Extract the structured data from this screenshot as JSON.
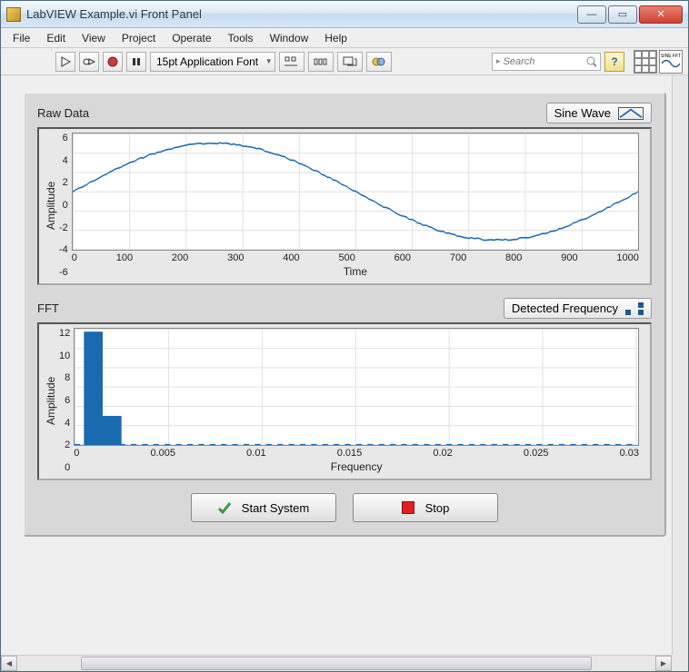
{
  "window": {
    "title": "LabVIEW Example.vi Front Panel"
  },
  "menu": {
    "file": "File",
    "edit": "Edit",
    "view": "View",
    "project": "Project",
    "operate": "Operate",
    "tools": "Tools",
    "window": "Window",
    "help": "Help"
  },
  "toolbar": {
    "font": "15pt Application Font",
    "search_placeholder": "Search",
    "help": "?",
    "sine_label": "SINE FFT"
  },
  "chart1": {
    "title": "Raw Data",
    "legend": "Sine Wave",
    "ylabel": "Amplitude",
    "xlabel": "Time",
    "yticks": [
      "6",
      "4",
      "2",
      "0",
      "-2",
      "-4",
      "-6"
    ],
    "xticks": [
      "0",
      "100",
      "200",
      "300",
      "400",
      "500",
      "600",
      "700",
      "800",
      "900",
      "1000"
    ]
  },
  "chart2": {
    "title": "FFT",
    "legend": "Detected Frequency",
    "ylabel": "Amplitude",
    "xlabel": "Frequency",
    "yticks": [
      "12",
      "10",
      "8",
      "6",
      "4",
      "2",
      "0"
    ],
    "xticks": [
      "0",
      "0.005",
      "0.01",
      "0.015",
      "0.02",
      "0.025",
      "0.03"
    ]
  },
  "buttons": {
    "start": "Start System",
    "stop": "Stop"
  },
  "colors": {
    "series": "#1a6aaf",
    "bar": "#1a6aaf"
  },
  "chart_data": [
    {
      "type": "line",
      "title": "Raw Data",
      "xlabel": "Time",
      "ylabel": "Amplitude",
      "xlim": [
        0,
        1000
      ],
      "ylim": [
        -6,
        6
      ],
      "series": [
        {
          "name": "Sine Wave",
          "function": "5*sin(2*pi*x/1000) + noise(~0.1)",
          "sample_points_x": [
            0,
            100,
            200,
            300,
            400,
            500,
            600,
            700,
            800,
            900,
            1000
          ],
          "sample_points_y": [
            0.0,
            2.95,
            4.75,
            4.75,
            2.95,
            0.0,
            -2.95,
            -4.75,
            -4.75,
            -2.95,
            0.0
          ]
        }
      ]
    },
    {
      "type": "bar",
      "title": "FFT",
      "xlabel": "Frequency",
      "ylabel": "Amplitude",
      "xlim": [
        0,
        0.03
      ],
      "ylim": [
        0,
        12
      ],
      "series": [
        {
          "name": "Detected Frequency",
          "x": [
            0.001,
            0.002
          ],
          "values": [
            11.7,
            3.0
          ]
        }
      ]
    }
  ]
}
